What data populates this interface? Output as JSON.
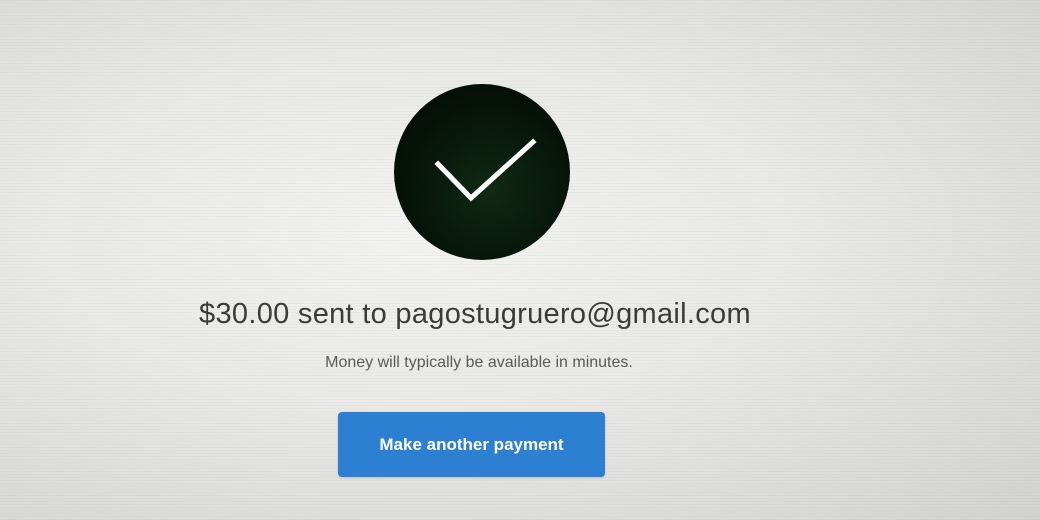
{
  "confirmation": {
    "icon": "checkmark-icon",
    "headline": "$30.00 sent to pagostugruero@gmail.com",
    "subtext": "Money will typically be available in minutes."
  },
  "actions": {
    "primary_label": "Make another payment"
  },
  "colors": {
    "success_circle": "#07140a",
    "button": "#2d7fd2",
    "button_text": "#ffffff"
  }
}
